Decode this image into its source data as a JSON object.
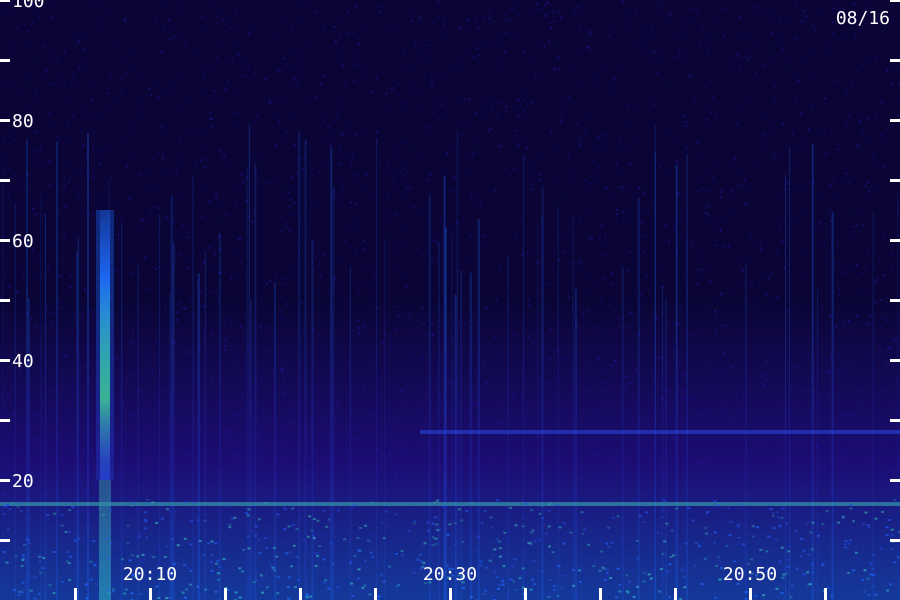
{
  "chart_data": {
    "type": "heatmap",
    "title": "",
    "xlabel": "",
    "ylabel": "",
    "date_label": "08/16",
    "y_axis": {
      "range": [
        0,
        100
      ],
      "tick_values": [
        10,
        20,
        30,
        40,
        50,
        60,
        70,
        80,
        90,
        100
      ],
      "labeled_ticks": [
        {
          "value": 20,
          "label": "20"
        },
        {
          "value": 40,
          "label": "40"
        },
        {
          "value": 60,
          "label": "60"
        },
        {
          "value": 80,
          "label": "80"
        },
        {
          "value": 100,
          "label": "100"
        }
      ]
    },
    "x_axis": {
      "range_minutes": [
        "20:00",
        "20:60"
      ],
      "tick_times": [
        "20:05",
        "20:10",
        "20:15",
        "20:20",
        "20:25",
        "20:30",
        "20:35",
        "20:40",
        "20:45",
        "20:50",
        "20:55"
      ],
      "labeled_ticks": [
        {
          "time": "20:10",
          "label": "20:10"
        },
        {
          "time": "20:30",
          "label": "20:30"
        },
        {
          "time": "20:50",
          "label": "20:50"
        }
      ]
    },
    "features": [
      {
        "kind": "vertical-burst",
        "time": "20:07",
        "y_range": [
          20,
          65
        ],
        "intensity": "high"
      },
      {
        "kind": "horizontal-band",
        "y": 28,
        "time_range": [
          "20:28",
          "20:60"
        ],
        "intensity": "medium"
      },
      {
        "kind": "horizontal-band",
        "y": 16,
        "time_range": [
          "20:00",
          "20:60"
        ],
        "intensity": "high"
      },
      {
        "kind": "diffuse-glow",
        "y_range": [
          0,
          50
        ],
        "intensity": "low"
      }
    ],
    "colors": {
      "background": "#0a0536",
      "low": "#2a14a8",
      "mid": "#1e6cff",
      "high": "#3fff8a",
      "axis": "#ffffff"
    }
  }
}
